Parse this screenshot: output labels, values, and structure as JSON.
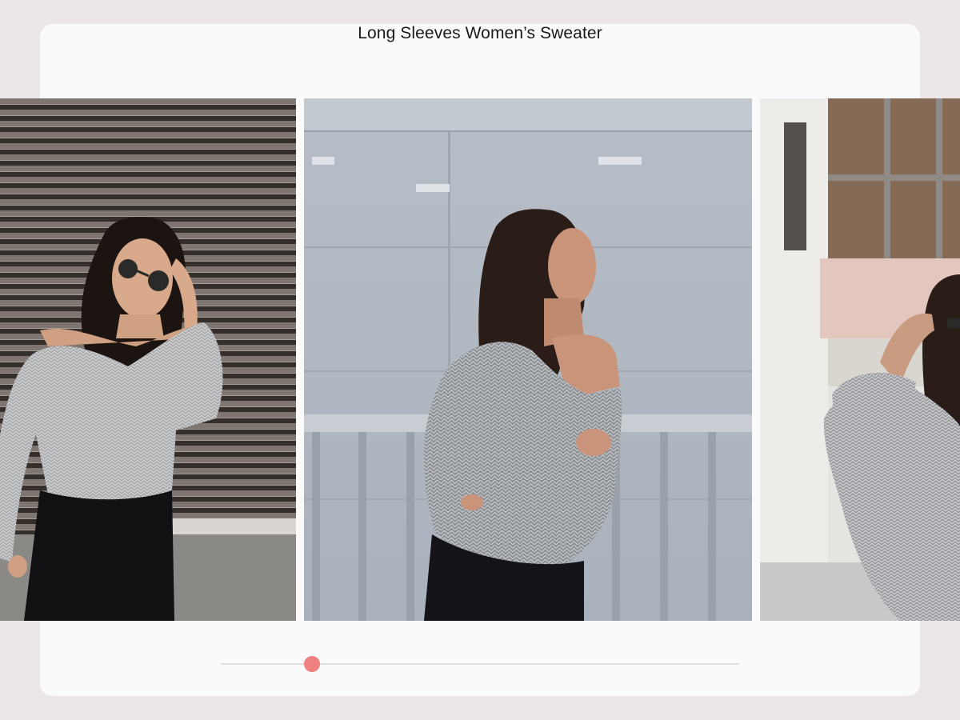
{
  "title": "Long Sleeves Women’s Sweater",
  "gallery": {
    "images": [
      {
        "name": "woman in grey knit sweater with sunglasses against shutter wall"
      },
      {
        "name": "woman in grey knit sweater beside railing, eyes closed"
      },
      {
        "name": "woman in grey knit sweater with sunglasses by building"
      }
    ]
  },
  "slider": {
    "position": 0.177,
    "accent_color": "#ef8080",
    "track_color": "#e0e0e0"
  },
  "colors": {
    "page_background": "#ece6e6",
    "card_background": "#fafafa"
  }
}
